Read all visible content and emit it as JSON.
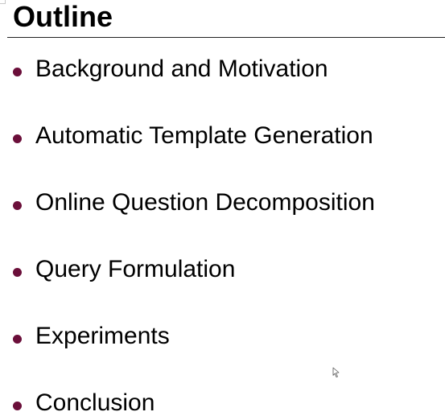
{
  "slide": {
    "title": "Outline",
    "bullet_color": "#6b0f3a",
    "bullets": [
      {
        "label": "Background and Motivation"
      },
      {
        "label": "Automatic Template Generation"
      },
      {
        "label": "Online Question Decomposition"
      },
      {
        "label": "Query Formulation"
      },
      {
        "label": "Experiments"
      },
      {
        "label": "Conclusion"
      }
    ]
  },
  "cursor": {
    "icon": "mouse-pointer-icon"
  }
}
